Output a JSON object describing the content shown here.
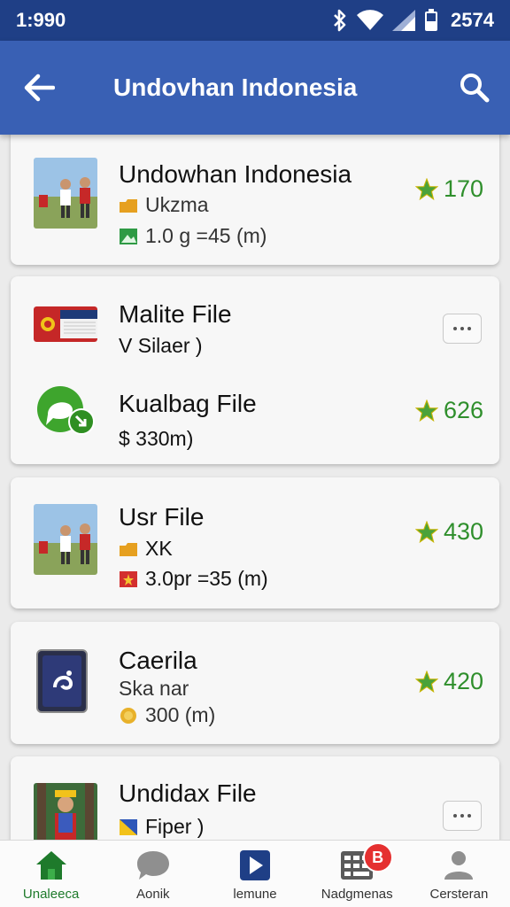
{
  "status_bar": {
    "time": "1:990",
    "battery_text": "2574"
  },
  "app_bar": {
    "title": "Undovhan Indonesia"
  },
  "items": [
    {
      "title": "Undowhan Indonesia",
      "meta1": "Ukzma",
      "meta2": "1.0 g  =45 (m)",
      "rating": "170"
    },
    {
      "title": "Malite File",
      "meta1": "V Silaer )"
    },
    {
      "title": "Kualbag File",
      "meta1": "$ 330m)",
      "rating": "626"
    },
    {
      "title": "Usr File",
      "meta1": "XK",
      "meta2": "3.0pr =35 (m)",
      "rating": "430"
    },
    {
      "title": "Caerila",
      "meta1": "Ska nar",
      "meta2": "300 (m)",
      "rating": "420"
    },
    {
      "title": "Undidax File",
      "meta1": "Fiper )"
    }
  ],
  "bottom_nav": [
    {
      "label": "Unaleeca",
      "icon": "home-icon",
      "active": true
    },
    {
      "label": "Aonik",
      "icon": "chat-icon"
    },
    {
      "label": "lemune",
      "icon": "play-icon"
    },
    {
      "label": "Nadgmenas",
      "icon": "grid-icon",
      "badge": "B"
    },
    {
      "label": "Cersteran",
      "icon": "person-icon"
    }
  ],
  "colors": {
    "status_bar": "#1f3f86",
    "app_bar": "#3960b4",
    "rating": "#2f8f2c",
    "active_nav": "#1e7a2b",
    "badge": "#e53030"
  }
}
